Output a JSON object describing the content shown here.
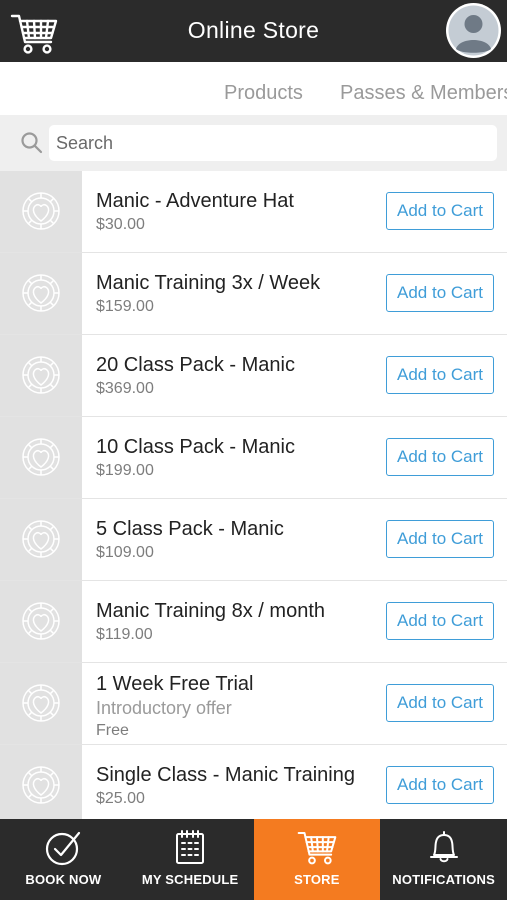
{
  "header": {
    "title": "Online Store"
  },
  "tabs": [
    {
      "label": "Products"
    },
    {
      "label": "Passes & Memberships"
    }
  ],
  "search": {
    "placeholder": "Search"
  },
  "products": [
    {
      "name": "Manic - Adventure Hat",
      "price": "$30.00",
      "button": "Add to Cart"
    },
    {
      "name": "Manic Training 3x / Week",
      "price": "$159.00",
      "button": "Add to Cart"
    },
    {
      "name": "20 Class Pack - Manic",
      "price": "$369.00",
      "button": "Add to Cart"
    },
    {
      "name": "10 Class Pack - Manic",
      "price": "$199.00",
      "button": "Add to Cart"
    },
    {
      "name": "5 Class Pack - Manic",
      "price": "$109.00",
      "button": "Add to Cart"
    },
    {
      "name": "Manic Training 8x / month",
      "price": "$119.00",
      "button": "Add to Cart"
    },
    {
      "name": "1 Week Free Trial",
      "subtitle": "Introductory offer",
      "price": "Free",
      "button": "Add to Cart"
    },
    {
      "name": "Single Class - Manic Training",
      "price": "$25.00",
      "button": "Add to Cart"
    }
  ],
  "tabbar": [
    {
      "label": "BOOK NOW",
      "icon": "check-circle-icon"
    },
    {
      "label": "MY SCHEDULE",
      "icon": "calendar-icon"
    },
    {
      "label": "STORE",
      "icon": "cart-icon",
      "active": true
    },
    {
      "label": "NOTIFICATIONS",
      "icon": "bell-icon"
    }
  ],
  "colors": {
    "header_bg": "#2b2b2b",
    "accent_blue": "#3f9dd8",
    "active_tab": "#f47b20"
  }
}
